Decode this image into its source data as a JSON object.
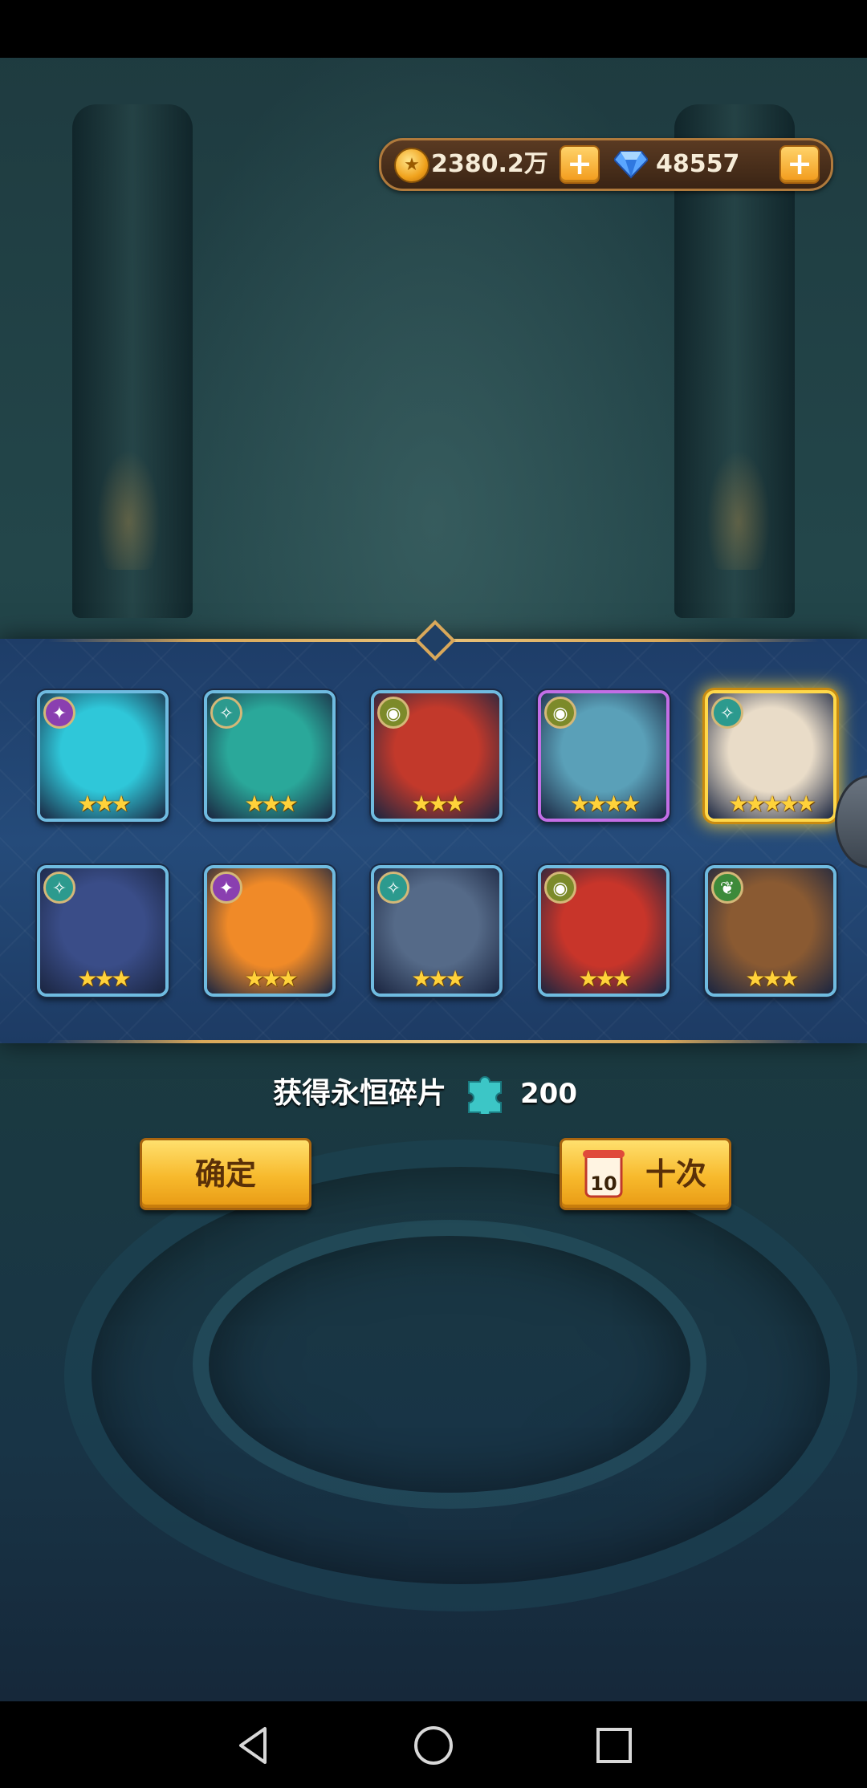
{
  "currency": {
    "gold_amount": "2380.2万",
    "diamond_amount": "48557"
  },
  "rewards": {
    "heroes": [
      {
        "stars": "★★★",
        "faction": "purple",
        "color": "#2fc7d9"
      },
      {
        "stars": "★★★",
        "faction": "teal",
        "color": "#2aa89a"
      },
      {
        "stars": "★★★",
        "faction": "olive",
        "color": "#c2392b"
      },
      {
        "stars": "★★★★",
        "faction": "olive",
        "color": "#5aa0b8"
      },
      {
        "stars": "★★★★★",
        "faction": "teal",
        "color": "#e9dcc8"
      },
      {
        "stars": "★★★",
        "faction": "teal",
        "color": "#3a4d88"
      },
      {
        "stars": "★★★",
        "faction": "purple",
        "color": "#f08a28"
      },
      {
        "stars": "★★★",
        "faction": "teal",
        "color": "#556a88"
      },
      {
        "stars": "★★★",
        "faction": "olive",
        "color": "#c8352a"
      },
      {
        "stars": "★★★",
        "faction": "green",
        "color": "#8a5a32"
      }
    ]
  },
  "result": {
    "label": "获得永恒碎片",
    "amount": "200"
  },
  "buttons": {
    "confirm": "确定",
    "ten_pull": "十次",
    "ten_badge": "10"
  },
  "colors": {
    "button_gold": "#f7b92c",
    "panel_blue": "#254b7a",
    "highlight_gold": "#ffd84a"
  }
}
